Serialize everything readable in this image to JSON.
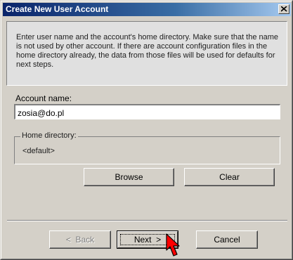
{
  "window": {
    "title": "Create New User Account"
  },
  "info": {
    "text": "Enter user name and the account's home directory. Make sure that the name is not used by other account. If there are account configuration files in the home directory already, the data from those files will be used for defaults for next steps."
  },
  "account": {
    "label": "Account name:",
    "value": "zosia@do.pl"
  },
  "home_directory": {
    "label": "Home directory:",
    "value": "<default>"
  },
  "buttons": {
    "browse": "Browse",
    "clear": "Clear",
    "back_arrow": "<",
    "back": "Back",
    "next": "Next",
    "next_arrow": ">",
    "cancel": "Cancel"
  },
  "colors": {
    "title_gradient_start": "#0a246a",
    "title_gradient_end": "#a6caf0",
    "face": "#d4d0c8",
    "cursor": "#ff0000"
  },
  "icons": {
    "close": "close-icon",
    "cursor": "mouse-pointer-icon"
  }
}
